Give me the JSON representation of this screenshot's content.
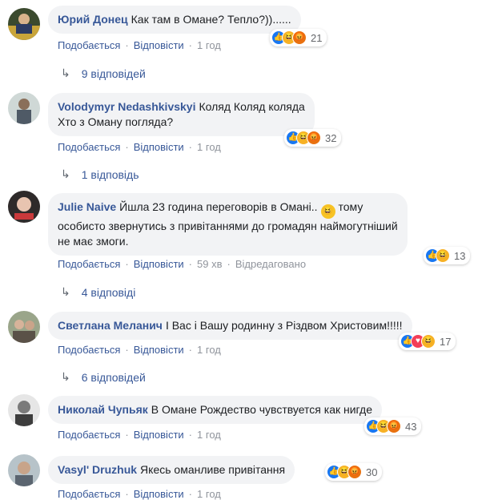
{
  "actions": {
    "like": "Подобається",
    "reply": "Відповісти",
    "edited": "Відредаговано"
  },
  "comments": [
    {
      "author": "Юрий Донец",
      "text": "Как там в Омане? Тепло?))......",
      "time": "1 год",
      "reactions": [
        "like",
        "haha",
        "angry"
      ],
      "reaction_count": "21",
      "replies": "9 відповідей",
      "edited": false
    },
    {
      "author": "Volodymyr Nedashkivskyi",
      "text_line1": "Коляд Коляд коляда",
      "text_line2": "Хто з Оману погляда?",
      "time": "1 год",
      "reactions": [
        "like",
        "haha",
        "angry"
      ],
      "reaction_count": "32",
      "replies": "1 відповідь",
      "edited": false
    },
    {
      "author": "Julie Naive",
      "text_line1": "Йшла 23 година переговорів в Омані..",
      "text_line1b": "тому",
      "text_line2": "особисто звернутись з привітаннями до громадян наймогутніший",
      "text_line3": "не має змоги.",
      "time": "59 хв",
      "reactions": [
        "like",
        "haha"
      ],
      "reaction_count": "13",
      "replies": "4 відповіді",
      "edited": true
    },
    {
      "author": "Светлана Меланич",
      "text": "І Вас і Вашу родинну з Різдвом Христовим!!!!!",
      "time": "1 год",
      "reactions": [
        "like",
        "love",
        "haha"
      ],
      "reaction_count": "17",
      "replies": "6 відповідей",
      "edited": false
    },
    {
      "author": "Николай Чупьяк",
      "text": "В Омане Рождество чувствуется как нигде",
      "time": "1 год",
      "reactions": [
        "like",
        "haha",
        "angry"
      ],
      "reaction_count": "43",
      "edited": false
    },
    {
      "author": "Vasyl' Druzhuk",
      "text": "Якесь оманливе привітання",
      "time": "1 год",
      "reactions": [
        "like",
        "haha",
        "angry"
      ],
      "reaction_count": "30",
      "edited": false
    }
  ]
}
